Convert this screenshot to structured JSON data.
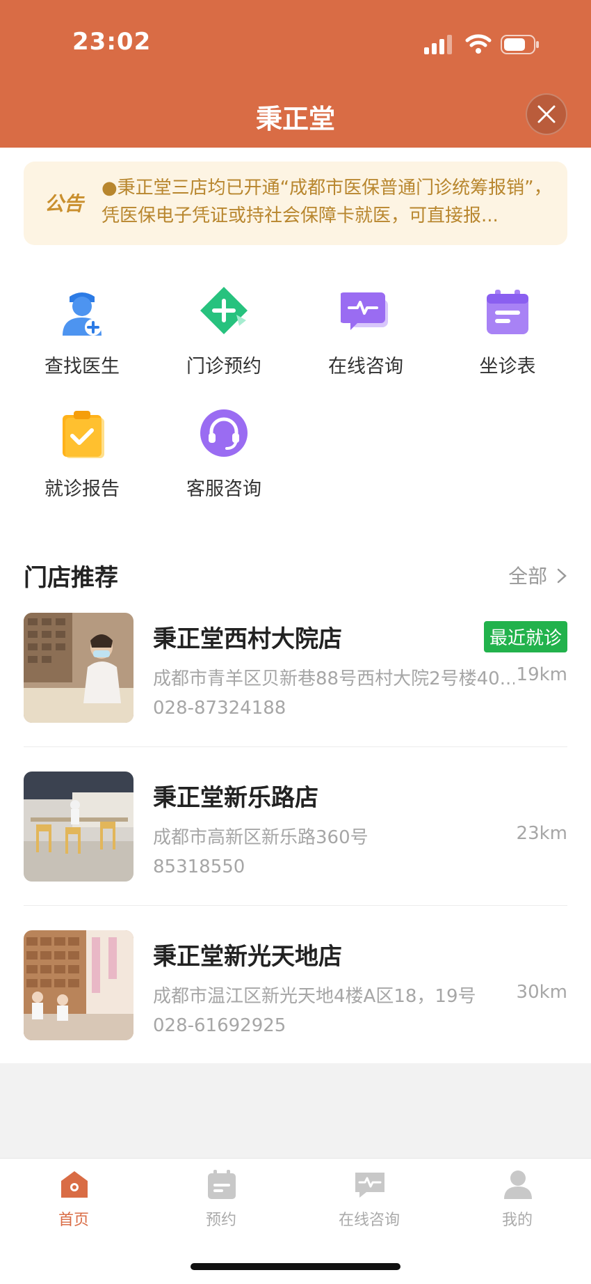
{
  "status_bar": {
    "time": "23:02"
  },
  "nav": {
    "title": "秉正堂"
  },
  "notice": {
    "badge": "公告",
    "text": "●秉正堂三店均已开通“成都市医保普通门诊统筹报销”，凭医保电子凭证或持社会保障卡就医，可直接报..."
  },
  "quick_actions": [
    {
      "label": "查找医生",
      "icon": "doctor-icon"
    },
    {
      "label": "门诊预约",
      "icon": "plus-diamond-icon"
    },
    {
      "label": "在线咨询",
      "icon": "chat-pulse-icon"
    },
    {
      "label": "坐诊表",
      "icon": "calendar-icon"
    },
    {
      "label": "就诊报告",
      "icon": "clipboard-check-icon"
    },
    {
      "label": "客服咨询",
      "icon": "headset-icon"
    }
  ],
  "stores_section": {
    "title": "门店推荐",
    "more": "全部"
  },
  "stores": [
    {
      "name": "秉正堂西村大院店",
      "address": "成都市青羊区贝新巷88号西村大院2号楼40...",
      "distance": "19km",
      "phone": "028-87324188",
      "tag": "最近就诊"
    },
    {
      "name": "秉正堂新乐路店",
      "address": "成都市高新区新乐路360号",
      "distance": "23km",
      "phone": "85318550"
    },
    {
      "name": "秉正堂新光天地店",
      "address": "成都市温江区新光天地4楼A区18，19号",
      "distance": "30km",
      "phone": "028-61692925"
    }
  ],
  "tabs": [
    {
      "label": "首页",
      "icon": "home-icon",
      "active": true
    },
    {
      "label": "预约",
      "icon": "calendar-icon"
    },
    {
      "label": "在线咨询",
      "icon": "chat-icon"
    },
    {
      "label": "我的",
      "icon": "user-icon"
    }
  ],
  "colors": {
    "brand": "#d96c45",
    "notice_text": "#b8862e",
    "tag_green": "#22b24c"
  }
}
